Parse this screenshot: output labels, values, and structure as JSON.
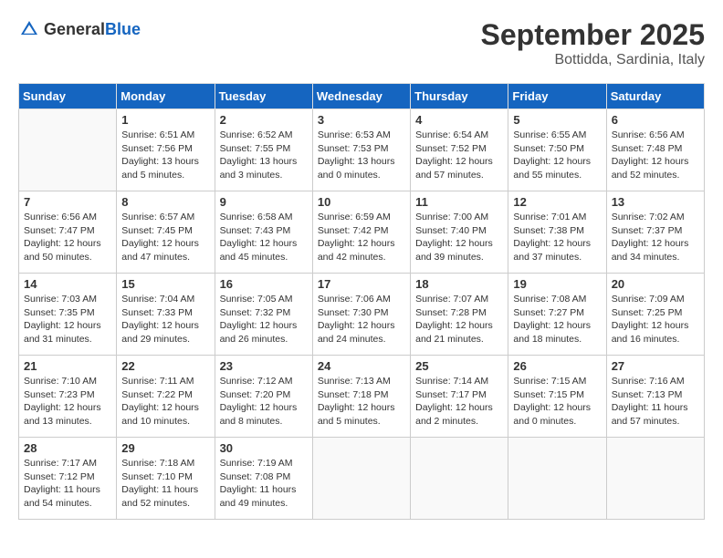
{
  "header": {
    "logo_general": "General",
    "logo_blue": "Blue",
    "month_title": "September 2025",
    "subtitle": "Bottidda, Sardinia, Italy"
  },
  "weekdays": [
    "Sunday",
    "Monday",
    "Tuesday",
    "Wednesday",
    "Thursday",
    "Friday",
    "Saturday"
  ],
  "weeks": [
    [
      {
        "day": "",
        "info": ""
      },
      {
        "day": "1",
        "info": "Sunrise: 6:51 AM\nSunset: 7:56 PM\nDaylight: 13 hours\nand 5 minutes."
      },
      {
        "day": "2",
        "info": "Sunrise: 6:52 AM\nSunset: 7:55 PM\nDaylight: 13 hours\nand 3 minutes."
      },
      {
        "day": "3",
        "info": "Sunrise: 6:53 AM\nSunset: 7:53 PM\nDaylight: 13 hours\nand 0 minutes."
      },
      {
        "day": "4",
        "info": "Sunrise: 6:54 AM\nSunset: 7:52 PM\nDaylight: 12 hours\nand 57 minutes."
      },
      {
        "day": "5",
        "info": "Sunrise: 6:55 AM\nSunset: 7:50 PM\nDaylight: 12 hours\nand 55 minutes."
      },
      {
        "day": "6",
        "info": "Sunrise: 6:56 AM\nSunset: 7:48 PM\nDaylight: 12 hours\nand 52 minutes."
      }
    ],
    [
      {
        "day": "7",
        "info": "Sunrise: 6:56 AM\nSunset: 7:47 PM\nDaylight: 12 hours\nand 50 minutes."
      },
      {
        "day": "8",
        "info": "Sunrise: 6:57 AM\nSunset: 7:45 PM\nDaylight: 12 hours\nand 47 minutes."
      },
      {
        "day": "9",
        "info": "Sunrise: 6:58 AM\nSunset: 7:43 PM\nDaylight: 12 hours\nand 45 minutes."
      },
      {
        "day": "10",
        "info": "Sunrise: 6:59 AM\nSunset: 7:42 PM\nDaylight: 12 hours\nand 42 minutes."
      },
      {
        "day": "11",
        "info": "Sunrise: 7:00 AM\nSunset: 7:40 PM\nDaylight: 12 hours\nand 39 minutes."
      },
      {
        "day": "12",
        "info": "Sunrise: 7:01 AM\nSunset: 7:38 PM\nDaylight: 12 hours\nand 37 minutes."
      },
      {
        "day": "13",
        "info": "Sunrise: 7:02 AM\nSunset: 7:37 PM\nDaylight: 12 hours\nand 34 minutes."
      }
    ],
    [
      {
        "day": "14",
        "info": "Sunrise: 7:03 AM\nSunset: 7:35 PM\nDaylight: 12 hours\nand 31 minutes."
      },
      {
        "day": "15",
        "info": "Sunrise: 7:04 AM\nSunset: 7:33 PM\nDaylight: 12 hours\nand 29 minutes."
      },
      {
        "day": "16",
        "info": "Sunrise: 7:05 AM\nSunset: 7:32 PM\nDaylight: 12 hours\nand 26 minutes."
      },
      {
        "day": "17",
        "info": "Sunrise: 7:06 AM\nSunset: 7:30 PM\nDaylight: 12 hours\nand 24 minutes."
      },
      {
        "day": "18",
        "info": "Sunrise: 7:07 AM\nSunset: 7:28 PM\nDaylight: 12 hours\nand 21 minutes."
      },
      {
        "day": "19",
        "info": "Sunrise: 7:08 AM\nSunset: 7:27 PM\nDaylight: 12 hours\nand 18 minutes."
      },
      {
        "day": "20",
        "info": "Sunrise: 7:09 AM\nSunset: 7:25 PM\nDaylight: 12 hours\nand 16 minutes."
      }
    ],
    [
      {
        "day": "21",
        "info": "Sunrise: 7:10 AM\nSunset: 7:23 PM\nDaylight: 12 hours\nand 13 minutes."
      },
      {
        "day": "22",
        "info": "Sunrise: 7:11 AM\nSunset: 7:22 PM\nDaylight: 12 hours\nand 10 minutes."
      },
      {
        "day": "23",
        "info": "Sunrise: 7:12 AM\nSunset: 7:20 PM\nDaylight: 12 hours\nand 8 minutes."
      },
      {
        "day": "24",
        "info": "Sunrise: 7:13 AM\nSunset: 7:18 PM\nDaylight: 12 hours\nand 5 minutes."
      },
      {
        "day": "25",
        "info": "Sunrise: 7:14 AM\nSunset: 7:17 PM\nDaylight: 12 hours\nand 2 minutes."
      },
      {
        "day": "26",
        "info": "Sunrise: 7:15 AM\nSunset: 7:15 PM\nDaylight: 12 hours\nand 0 minutes."
      },
      {
        "day": "27",
        "info": "Sunrise: 7:16 AM\nSunset: 7:13 PM\nDaylight: 11 hours\nand 57 minutes."
      }
    ],
    [
      {
        "day": "28",
        "info": "Sunrise: 7:17 AM\nSunset: 7:12 PM\nDaylight: 11 hours\nand 54 minutes."
      },
      {
        "day": "29",
        "info": "Sunrise: 7:18 AM\nSunset: 7:10 PM\nDaylight: 11 hours\nand 52 minutes."
      },
      {
        "day": "30",
        "info": "Sunrise: 7:19 AM\nSunset: 7:08 PM\nDaylight: 11 hours\nand 49 minutes."
      },
      {
        "day": "",
        "info": ""
      },
      {
        "day": "",
        "info": ""
      },
      {
        "day": "",
        "info": ""
      },
      {
        "day": "",
        "info": ""
      }
    ]
  ]
}
